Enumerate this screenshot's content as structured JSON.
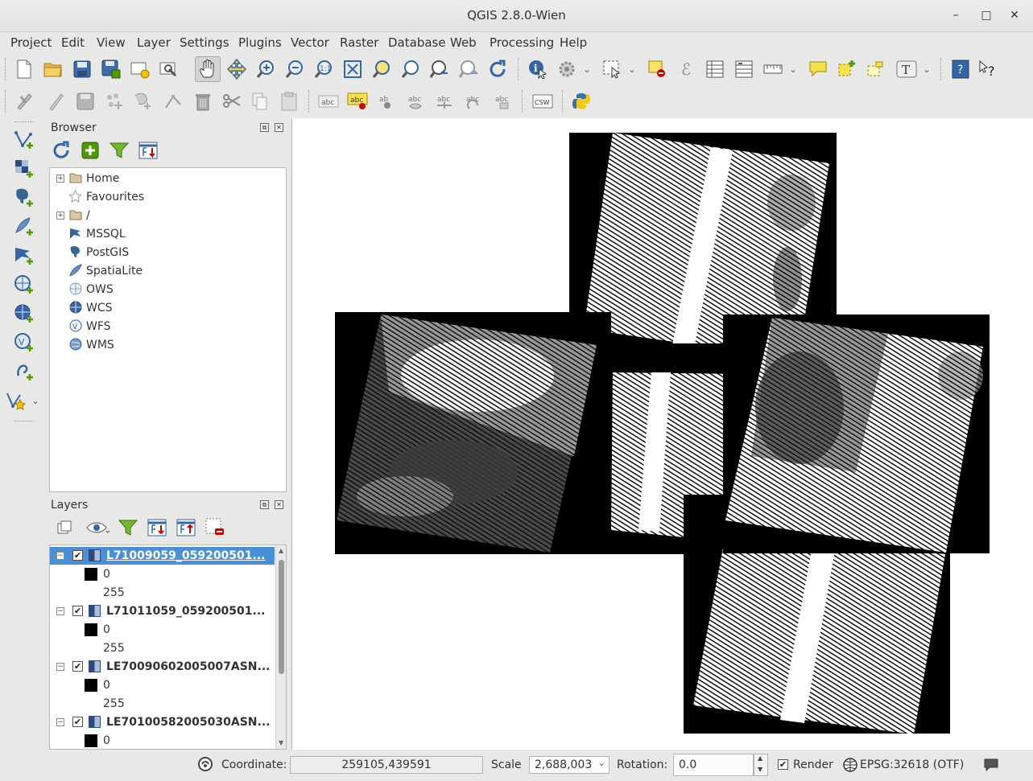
{
  "window": {
    "title": "QGIS 2.8.0-Wien",
    "minimize": "–",
    "maximize": "□",
    "close": "✕"
  },
  "menubar": {
    "items": [
      "Project",
      "Edit",
      "View",
      "Layer",
      "Settings",
      "Plugins",
      "Vector",
      "Raster",
      "Database",
      "Web",
      "Processing",
      "Help"
    ]
  },
  "toolbar_icons": {
    "row1": [
      "new-project",
      "open-project",
      "save-project",
      "save-as",
      "new-print-composer",
      "composer-manager",
      "pan-map",
      "pan-to-selection",
      "zoom-in",
      "zoom-out",
      "zoom-actual-size",
      "zoom-full",
      "zoom-to-selection",
      "zoom-to-layer",
      "zoom-last",
      "zoom-next",
      "refresh",
      "identify",
      "run-action",
      "select-features",
      "deselect",
      "field-calculator",
      "attribute-table",
      "statistics",
      "measure-line",
      "map-tips",
      "text-annotation",
      "new-bookmark",
      "text-annotation-t",
      "help-contents",
      "whats-this"
    ],
    "row2": [
      "toggle-editing",
      "current-edits",
      "save-edits",
      "add-feature",
      "move-feature",
      "node-tool",
      "delete-selected",
      "cut-features",
      "copy-features",
      "paste-features",
      "label-tool",
      "label-pin",
      "label-show-hide",
      "label-move",
      "label-rotate",
      "label-change",
      "csw-search",
      "python-console"
    ],
    "left": [
      "add-vector-layer",
      "add-raster-layer",
      "add-postgis-layer",
      "add-spatialite-layer",
      "add-mssql-layer",
      "add-wms-layer",
      "add-wcs-layer",
      "add-wfs-layer",
      "add-delimited-text-layer",
      "new-shapefile-layer"
    ]
  },
  "browser": {
    "title": "Browser",
    "items": [
      {
        "label": "Home",
        "icon": "folder-icon",
        "expandable": true
      },
      {
        "label": "Favourites",
        "icon": "star-icon",
        "expandable": false
      },
      {
        "label": "/",
        "icon": "folder-icon",
        "expandable": true
      },
      {
        "label": "MSSQL",
        "icon": "mssql-icon",
        "expandable": false
      },
      {
        "label": "PostGIS",
        "icon": "postgis-icon",
        "expandable": false
      },
      {
        "label": "SpatiaLite",
        "icon": "spatialite-icon",
        "expandable": false
      },
      {
        "label": "OWS",
        "icon": "ows-icon",
        "expandable": false
      },
      {
        "label": "WCS",
        "icon": "wcs-icon",
        "expandable": false
      },
      {
        "label": "WFS",
        "icon": "wfs-icon",
        "expandable": false
      },
      {
        "label": "WMS",
        "icon": "wms-icon",
        "expandable": false
      }
    ]
  },
  "layers": {
    "title": "Layers",
    "items": [
      {
        "name": "L71009059_059200501...",
        "selected": true,
        "checked": true,
        "min": "0",
        "max": "255"
      },
      {
        "name": "L71011059_059200501...",
        "selected": false,
        "checked": true,
        "min": "0",
        "max": "255"
      },
      {
        "name": "LE70090602005007ASN...",
        "selected": false,
        "checked": true,
        "min": "0",
        "max": "255"
      },
      {
        "name": "LE70100582005030ASN...",
        "selected": false,
        "checked": true,
        "min": "0",
        "max": ""
      }
    ]
  },
  "statusbar": {
    "coordinate_label": "Coordinate:",
    "coordinate_value": "259105,439591",
    "scale_label": "Scale",
    "scale_value": "2,688,003",
    "rotation_label": "Rotation:",
    "rotation_value": "0.0",
    "render_label": "Render",
    "render_checked": true,
    "crs_label": "EPSG:32618 (OTF)"
  },
  "colors": {
    "selection": "#4a90d9",
    "accent_blue": "#3465a4",
    "green_plus": "#4e9a06"
  }
}
